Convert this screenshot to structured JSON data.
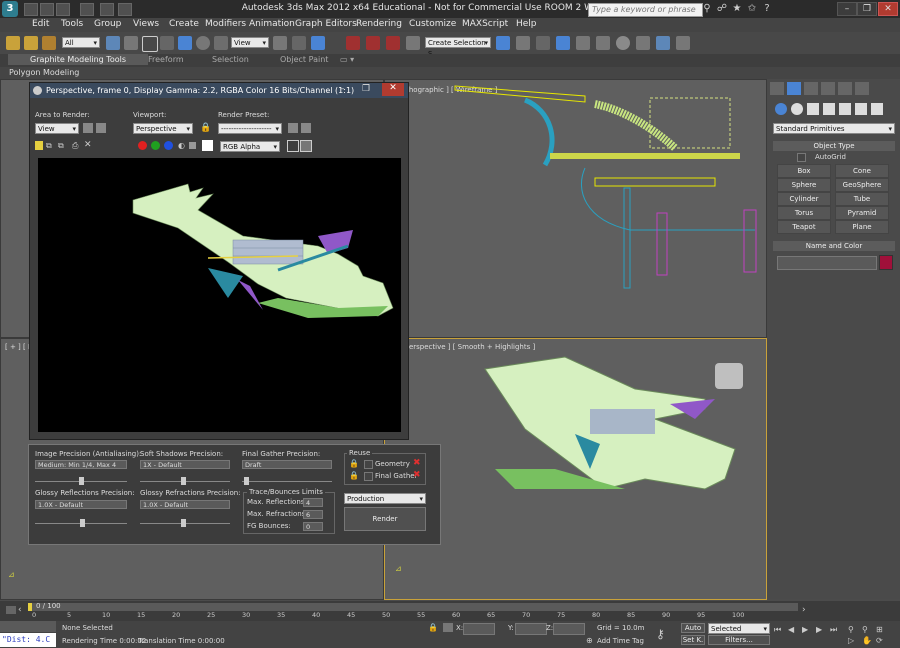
{
  "app": {
    "title": "Autodesk 3ds Max  2012 x64    Educational  - Not for Commercial Use    ROOM 2 WORKSHOP.max",
    "logo_text": "3",
    "search_placeholder": "Type a keyword or phrase",
    "window_buttons": [
      "–",
      "❐",
      "✕"
    ]
  },
  "menu": [
    "Edit",
    "Tools",
    "Group",
    "Views",
    "Create",
    "Modifiers",
    "Animation",
    "Graph Editors",
    "Rendering",
    "Customize",
    "MAXScript",
    "Help"
  ],
  "toolbar": {
    "selection_filter": "All",
    "reference_coord": "View",
    "angle_snap": "3",
    "named_selection": "Create Selection S"
  },
  "ribbon": {
    "tabs": [
      "Graphite Modeling Tools",
      "Freeform",
      "Selection",
      "Object Paint"
    ],
    "sub_label": "Polygon Modeling"
  },
  "viewports": {
    "top_right_label": "chographic ] [ Wireframe ]",
    "bottom_left_label": "[ + ] [ Le",
    "bottom_right_label": "Perspective ] [ Smooth + Highlights ]"
  },
  "render_window": {
    "title": "Perspective, frame 0, Display Gamma: 2.2, RGBA Color 16 Bits/Channel (1:1)",
    "area_label": "Area to Render:",
    "area_value": "View",
    "viewport_label": "Viewport:",
    "viewport_value": "Perspective",
    "preset_label": "Render Preset:",
    "preset_value": "--------------------",
    "channel_value": "RGB Alpha",
    "channel_colors": [
      "#e02020",
      "#20a020",
      "#2050e0"
    ]
  },
  "render_panel": {
    "image_precision_label": "Image Precision (Antialiasing):",
    "image_precision_value": "Medium: Min 1/4, Max 4",
    "soft_shadows_label": "Soft Shadows Precision:",
    "soft_shadows_value": "1X - Default",
    "final_gather_label": "Final Gather Precision:",
    "final_gather_value": "Draft",
    "glossy_refl_label": "Glossy Reflections Precision:",
    "glossy_refl_value": "1.0X - Default",
    "glossy_refr_label": "Glossy Refractions Precision:",
    "glossy_refr_value": "1.0X - Default",
    "reuse_label": "Reuse",
    "geometry_label": "Geometry",
    "final_gather_reuse_label": "Final Gather",
    "trace_label": "Trace/Bounces Limits",
    "max_reflections_label": "Max. Reflections:",
    "max_reflections_value": "4",
    "max_refractions_label": "Max. Refractions:",
    "max_refractions_value": "6",
    "fg_bounces_label": "FG Bounces:",
    "fg_bounces_value": "0",
    "mode_value": "Production",
    "render_button": "Render"
  },
  "command_panel": {
    "category": "Standard Primitives",
    "object_type_header": "Object Type",
    "autogrid_label": "AutoGrid",
    "buttons": [
      "Box",
      "Cone",
      "Sphere",
      "GeoSphere",
      "Cylinder",
      "Tube",
      "Torus",
      "Pyramid",
      "Teapot",
      "Plane"
    ],
    "name_color_header": "Name and Color",
    "object_color": "#a0103a"
  },
  "timeline": {
    "frame_counter": "0 / 100",
    "ticks": [
      "0",
      "5",
      "10",
      "15",
      "20",
      "25",
      "30",
      "35",
      "40",
      "45",
      "50",
      "55",
      "60",
      "65",
      "70",
      "75",
      "80",
      "85",
      "90",
      "95",
      "100"
    ]
  },
  "status": {
    "script_text": "\"Dist: 4.C",
    "selection_text": "None Selected",
    "render_time": "Rendering Time  0:00:02",
    "translation_time": "Translation Time  0:00:00",
    "x_label": "X:",
    "y_label": "Y:",
    "z_label": "Z:",
    "grid": "Grid = 10.0m",
    "add_time_tag": "Add Time Tag",
    "auto_label": "Auto",
    "set_key_label": "Set K.",
    "selected_value": "Selected",
    "filters_label": "Filters..."
  }
}
